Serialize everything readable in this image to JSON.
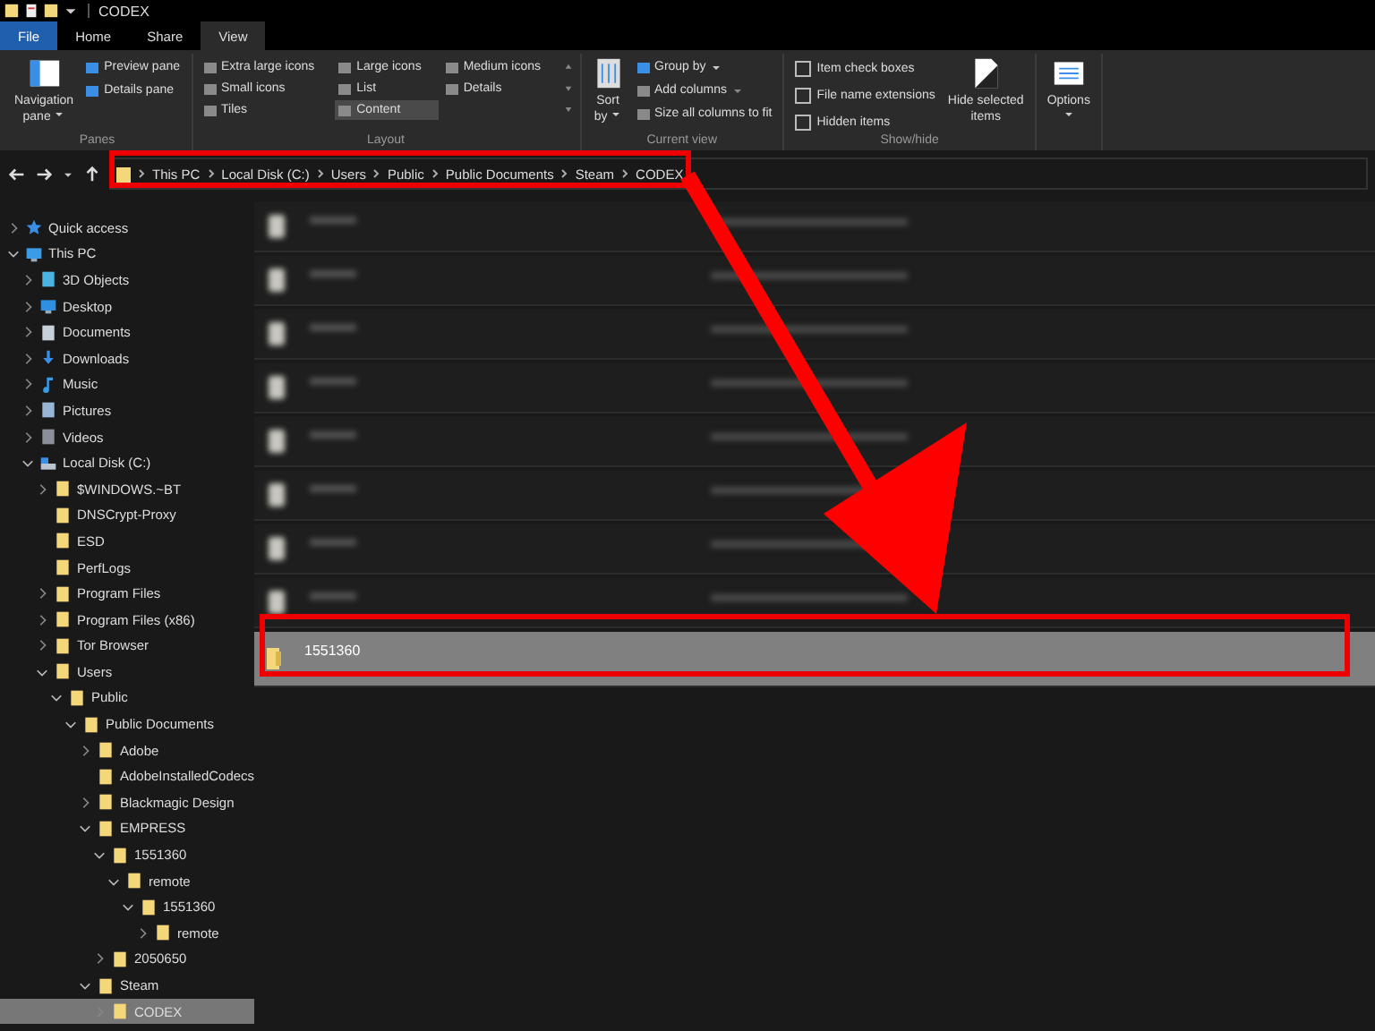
{
  "window": {
    "title": "CODEX"
  },
  "tabs": [
    {
      "label": "File",
      "kind": "file",
      "selected": false
    },
    {
      "label": "Home",
      "kind": "tab",
      "selected": false
    },
    {
      "label": "Share",
      "kind": "tab",
      "selected": false
    },
    {
      "label": "View",
      "kind": "tab",
      "selected": true
    }
  ],
  "ribbon": {
    "panes": {
      "label": "Panes",
      "navigation": "Navigation",
      "navigation_2": "pane",
      "preview": "Preview pane",
      "details": "Details pane"
    },
    "layout": {
      "label": "Layout",
      "items": [
        {
          "label": "Extra large icons",
          "selected": false
        },
        {
          "label": "Large icons",
          "selected": false
        },
        {
          "label": "Medium icons",
          "selected": false
        },
        {
          "label": "Small icons",
          "selected": false
        },
        {
          "label": "List",
          "selected": false
        },
        {
          "label": "Details",
          "selected": false
        },
        {
          "label": "Tiles",
          "selected": false
        },
        {
          "label": "Content",
          "selected": true
        }
      ]
    },
    "current_view": {
      "label": "Current view",
      "sort": "Sort",
      "sort_2": "by",
      "group_by": "Group by",
      "add_columns": "Add columns",
      "size_columns": "Size all columns to fit"
    },
    "show_hide": {
      "label": "Show/hide",
      "checkboxes": [
        {
          "label": "Item check boxes",
          "checked": false
        },
        {
          "label": "File name extensions",
          "checked": false
        },
        {
          "label": "Hidden items",
          "checked": false
        }
      ],
      "hide_selected": "Hide selected",
      "hide_selected_2": "items"
    },
    "options": {
      "label": "Options"
    }
  },
  "breadcrumbs": [
    "This PC",
    "Local Disk (C:)",
    "Users",
    "Public",
    "Public Documents",
    "Steam",
    "CODEX"
  ],
  "tree": [
    {
      "label": "Quick access",
      "kind": "star",
      "expanded": false,
      "selected": false
    },
    {
      "label": "This PC",
      "kind": "computer",
      "expanded": true,
      "selected": false,
      "children": [
        {
          "label": "3D Objects",
          "kind": "cube",
          "expanded": false,
          "selected": false
        },
        {
          "label": "Desktop",
          "kind": "desktop",
          "expanded": false,
          "selected": false
        },
        {
          "label": "Documents",
          "kind": "document",
          "expanded": false,
          "selected": false
        },
        {
          "label": "Downloads",
          "kind": "download",
          "expanded": false,
          "selected": false
        },
        {
          "label": "Music",
          "kind": "music",
          "expanded": false,
          "selected": false
        },
        {
          "label": "Pictures",
          "kind": "picture",
          "expanded": false,
          "selected": false
        },
        {
          "label": "Videos",
          "kind": "video",
          "expanded": false,
          "selected": false
        },
        {
          "label": "Local Disk (C:)",
          "kind": "drive",
          "expanded": true,
          "selected": false,
          "children": [
            {
              "label": "$WINDOWS.~BT",
              "kind": "folder",
              "expanded": false,
              "selected": false
            },
            {
              "label": "DNSCrypt-Proxy",
              "kind": "folder",
              "selected": false
            },
            {
              "label": "ESD",
              "kind": "folder",
              "selected": false
            },
            {
              "label": "PerfLogs",
              "kind": "folder",
              "selected": false
            },
            {
              "label": "Program Files",
              "kind": "folder",
              "expanded": false,
              "selected": false
            },
            {
              "label": "Program Files (x86)",
              "kind": "folder",
              "expanded": false,
              "selected": false
            },
            {
              "label": "Tor Browser",
              "kind": "folder",
              "expanded": false,
              "selected": false
            },
            {
              "label": "Users",
              "kind": "folder",
              "expanded": true,
              "selected": false,
              "children": [
                {
                  "label": "Public",
                  "kind": "folder",
                  "expanded": true,
                  "selected": false,
                  "children": [
                    {
                      "label": "Public Documents",
                      "kind": "folder",
                      "expanded": true,
                      "selected": false,
                      "children": [
                        {
                          "label": "Adobe",
                          "kind": "folder",
                          "expanded": false,
                          "selected": false
                        },
                        {
                          "label": "AdobeInstalledCodecs",
                          "kind": "folder",
                          "selected": false
                        },
                        {
                          "label": "Blackmagic Design",
                          "kind": "folder",
                          "expanded": false,
                          "selected": false
                        },
                        {
                          "label": "EMPRESS",
                          "kind": "folder",
                          "expanded": true,
                          "selected": false,
                          "children": [
                            {
                              "label": "1551360",
                              "kind": "folder",
                              "expanded": true,
                              "selected": false,
                              "children": [
                                {
                                  "label": "remote",
                                  "kind": "folder",
                                  "expanded": true,
                                  "selected": false,
                                  "children": [
                                    {
                                      "label": "1551360",
                                      "kind": "folder",
                                      "expanded": true,
                                      "selected": false,
                                      "children": [
                                        {
                                          "label": "remote",
                                          "kind": "folder",
                                          "expanded": false,
                                          "selected": false
                                        }
                                      ]
                                    }
                                  ]
                                }
                              ]
                            },
                            {
                              "label": "2050650",
                              "kind": "folder",
                              "expanded": false,
                              "selected": false
                            }
                          ]
                        },
                        {
                          "label": "Steam",
                          "kind": "folder",
                          "expanded": true,
                          "selected": false,
                          "children": [
                            {
                              "label": "CODEX",
                              "kind": "folder",
                              "expanded": false,
                              "selected": true
                            }
                          ]
                        }
                      ]
                    }
                  ]
                }
              ]
            }
          ]
        }
      ]
    }
  ],
  "files": [
    {
      "kind": "blurred",
      "selected": false
    },
    {
      "kind": "blurred",
      "selected": false
    },
    {
      "kind": "blurred",
      "selected": false
    },
    {
      "kind": "blurred",
      "selected": false
    },
    {
      "kind": "blurred",
      "selected": false
    },
    {
      "kind": "blurred",
      "selected": false
    },
    {
      "kind": "blurred",
      "selected": false
    },
    {
      "kind": "blurred",
      "selected": false
    },
    {
      "kind": "folder",
      "name": "1551360",
      "selected": true
    }
  ]
}
